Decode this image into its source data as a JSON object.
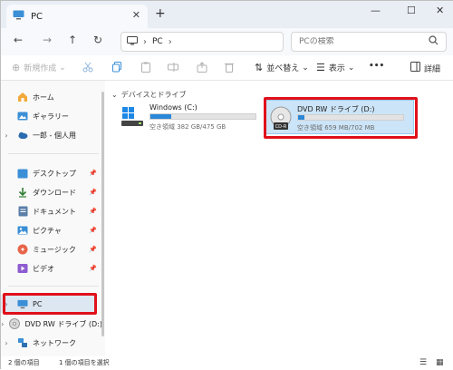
{
  "tab": {
    "title": "PC"
  },
  "titlebar": {
    "new_tab": "+",
    "minimize": "—",
    "maximize": "☐",
    "close": "✕",
    "tab_close": "✕"
  },
  "nav": {
    "back": "←",
    "forward": "→",
    "up": "↑",
    "refresh": "↻",
    "address_crumb": "PC",
    "address_sep": "›",
    "search_placeholder": "PCの検索"
  },
  "toolbar": {
    "new_label": "新規作成",
    "new_caret": "⌄",
    "sort_label": "並べ替え",
    "view_label": "表示",
    "more_label": "•••",
    "details_label": "詳細"
  },
  "sidebar": {
    "items": [
      {
        "label": "ホーム",
        "icon": "home-icon"
      },
      {
        "label": "ギャラリー",
        "icon": "gallery-icon"
      },
      {
        "label": "一郎 - 個人用",
        "icon": "cloud-icon"
      },
      {
        "label": "デスクトップ",
        "icon": "desktop-icon"
      },
      {
        "label": "ダウンロード",
        "icon": "download-icon"
      },
      {
        "label": "ドキュメント",
        "icon": "document-icon"
      },
      {
        "label": "ピクチャ",
        "icon": "pictures-icon"
      },
      {
        "label": "ミュージック",
        "icon": "music-icon"
      },
      {
        "label": "ビデオ",
        "icon": "video-icon"
      },
      {
        "label": "PC",
        "icon": "pc-icon"
      },
      {
        "label": "DVD RW ドライブ (D:)",
        "icon": "dvd-icon"
      },
      {
        "label": "ネットワーク",
        "icon": "network-icon"
      }
    ]
  },
  "content": {
    "group_header": "デバイスとドライブ",
    "drives": [
      {
        "name": "Windows (C:)",
        "size": "空き領域 382 GB/475 GB",
        "used_fraction": 0.196
      },
      {
        "name": "DVD RW ドライブ (D:)",
        "size": "空き領域 659 MB/702 MB",
        "used_fraction": 0.061
      }
    ],
    "dvd_label": "CD-R"
  },
  "status": {
    "item_count": "2 個の項目",
    "selected": "1 個の項目を選択"
  },
  "colors": {
    "accent": "#2b88d8",
    "highlight": "#e0101a",
    "selection": "#cce4f7"
  }
}
